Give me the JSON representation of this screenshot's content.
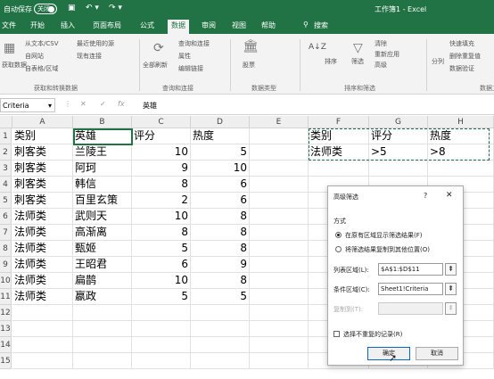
{
  "titlebar": {
    "autosave_label": "自动保存",
    "toggle_state": "关闭",
    "doc_title": "工作簿1 - Excel"
  },
  "tabs": [
    "文件",
    "开始",
    "插入",
    "页面布局",
    "公式",
    "数据",
    "审阅",
    "视图",
    "帮助",
    "搜索"
  ],
  "ribbon": {
    "get_data": {
      "big": "获取数据",
      "items": [
        "从文本/CSV",
        "自网站",
        "自表格/区域",
        "最近使用的源",
        "现有连接"
      ],
      "label": "获取和转换数据"
    },
    "queries": {
      "big": "全部刷新",
      "items": [
        "查询和连接",
        "属性",
        "编辑链接"
      ],
      "label": "查询和连接"
    },
    "types": {
      "big": "股票",
      "label": "数据类型"
    },
    "sort": {
      "items": [
        "排序",
        "筛选",
        "清除",
        "重新应用",
        "高级"
      ],
      "label": "排序和筛选"
    },
    "tools": {
      "items": [
        "分列",
        "快速填充",
        "删除重复值",
        "数据验证"
      ],
      "label": "数据工具"
    }
  },
  "formula_bar": {
    "name_box": "Criteria",
    "fx": "fx",
    "content": "英雄"
  },
  "columns": [
    "A",
    "B",
    "C",
    "D",
    "E",
    "F",
    "G",
    "H"
  ],
  "rows": [
    "1",
    "2",
    "3",
    "4",
    "5",
    "6",
    "7",
    "8",
    "9",
    "10",
    "11",
    "12",
    "13",
    "14",
    "15"
  ],
  "table": {
    "headers": [
      "类别",
      "英雄",
      "评分",
      "热度"
    ],
    "data": [
      [
        "刺客类",
        "兰陵王",
        "10",
        "5"
      ],
      [
        "刺客类",
        "阿珂",
        "9",
        "10"
      ],
      [
        "刺客类",
        "韩信",
        "8",
        "6"
      ],
      [
        "刺客类",
        "百里玄策",
        "2",
        "6"
      ],
      [
        "法师类",
        "武则天",
        "10",
        "8"
      ],
      [
        "法师类",
        "高渐离",
        "8",
        "8"
      ],
      [
        "法师类",
        "甄姬",
        "5",
        "8"
      ],
      [
        "法师类",
        "王昭君",
        "6",
        "9"
      ],
      [
        "法师类",
        "扁鹊",
        "10",
        "8"
      ],
      [
        "法师类",
        "嬴政",
        "5",
        "5"
      ]
    ]
  },
  "criteria": {
    "headers": [
      "类别",
      "评分",
      "热度"
    ],
    "values": [
      "法师类",
      ">5",
      ">8"
    ]
  },
  "dialog": {
    "title": "高级筛选",
    "help": "?",
    "close": "✕",
    "method_label": "方式",
    "option1": "在原有区域显示筛选结果(F)",
    "option2": "将筛选结果复制到其他位置(O)",
    "list_label": "列表区域(L):",
    "list_value": "$A$1:$D$11",
    "criteria_label": "条件区域(C):",
    "criteria_value": "Sheet1!Criteria",
    "copy_label": "复制到(T):",
    "copy_value": "",
    "unique_label": "选择不重复的记录(R)",
    "ok": "确定",
    "cancel": "取消"
  },
  "colors": {
    "accent": "#217346"
  }
}
